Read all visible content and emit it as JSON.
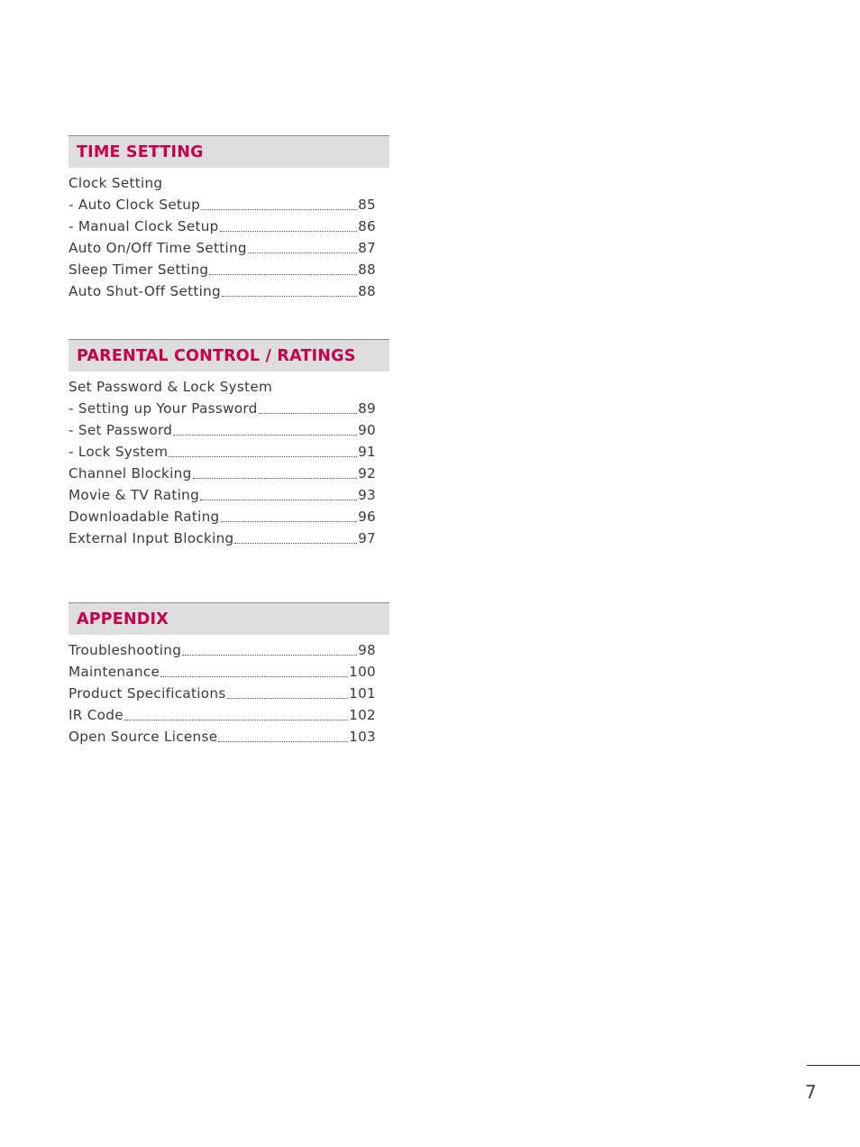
{
  "sections": [
    {
      "title": "TIME SETTING",
      "entries": [
        {
          "label": "Clock Setting",
          "page": ""
        },
        {
          "label": "- Auto Clock Setup",
          "page": "85"
        },
        {
          "label": "- Manual Clock Setup",
          "page": "86"
        },
        {
          "label": "Auto On/Off Time Setting",
          "page": "87"
        },
        {
          "label": "Sleep Timer Setting",
          "page": "88"
        },
        {
          "label": "Auto Shut-Off Setting",
          "page": "88"
        }
      ]
    },
    {
      "title": "PARENTAL CONTROL / RATINGS",
      "entries": [
        {
          "label": "Set Password & Lock System",
          "page": ""
        },
        {
          "label": "- Setting up Your Password",
          "page": "89"
        },
        {
          "label": "- Set Password",
          "page": "90"
        },
        {
          "label": "- Lock System",
          "page": "91"
        },
        {
          "label": "Channel Blocking",
          "page": "92"
        },
        {
          "label": "Movie & TV Rating",
          "page": "93"
        },
        {
          "label": "Downloadable Rating",
          "page": "96"
        },
        {
          "label": "External Input Blocking",
          "page": "97"
        }
      ]
    },
    {
      "title": "APPENDIX",
      "entries": [
        {
          "label": "Troubleshooting",
          "page": "98"
        },
        {
          "label": "Maintenance",
          "page": "100"
        },
        {
          "label": "Product Specifications",
          "page": "101"
        },
        {
          "label": "IR Code",
          "page": "102"
        },
        {
          "label": "Open Source License",
          "page": "103"
        }
      ]
    }
  ],
  "page_number": "7",
  "colors": {
    "accent": "#c5004d",
    "header_bg": "#dedede"
  }
}
